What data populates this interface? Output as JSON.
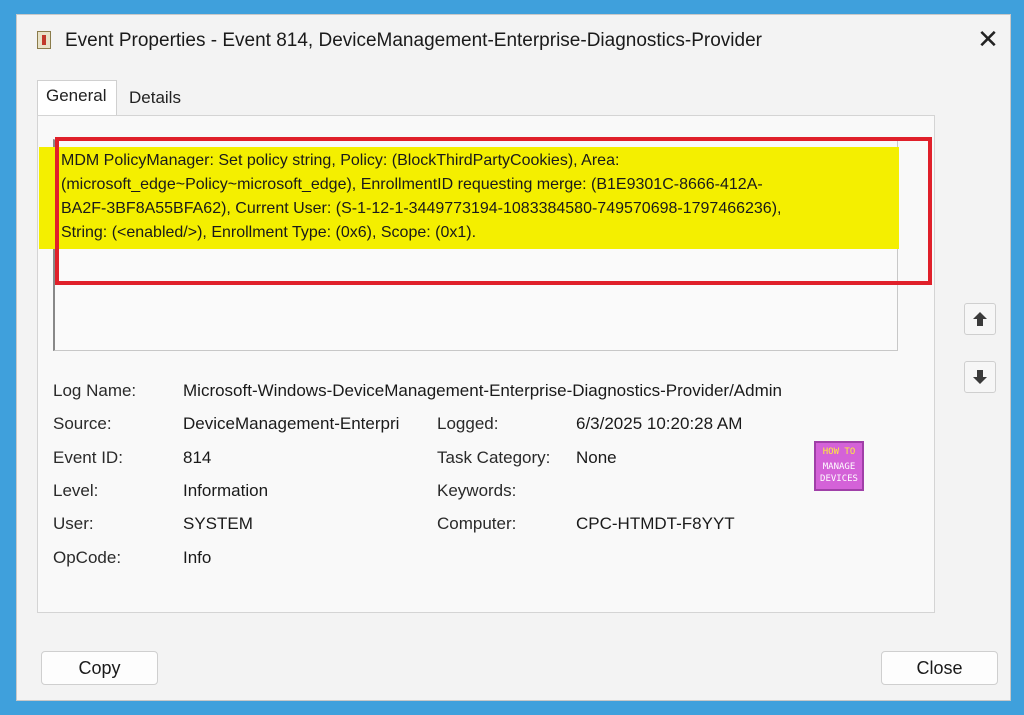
{
  "window": {
    "title": "Event Properties - Event 814, DeviceManagement-Enterprise-Diagnostics-Provider",
    "close_glyph": "✕"
  },
  "tabs": [
    {
      "label": "General",
      "active": true
    },
    {
      "label": "Details",
      "active": false
    }
  ],
  "description": {
    "lines": [
      "MDM PolicyManager: Set policy string, Policy: (BlockThirdPartyCookies), Area:",
      "(microsoft_edge~Policy~microsoft_edge), EnrollmentID requesting merge: (B1E9301C-8666-412A-",
      "BA2F-3BF8A55BFA62), Current User: (S-1-12-1-3449773194-1083384580-749570698-1797466236),",
      "String: (<enabled/>), Enrollment Type: (0x6), Scope: (0x1)."
    ],
    "highlight_color": "#f4ef00",
    "annotation_color": "#e0202a"
  },
  "nav": {
    "up_icon": "arrow-up-icon",
    "down_icon": "arrow-down-icon"
  },
  "fields": {
    "log_name_label": "Log Name:",
    "log_name": "Microsoft-Windows-DeviceManagement-Enterprise-Diagnostics-Provider/Admin",
    "source_label": "Source:",
    "source": "DeviceManagement-Enterpri",
    "logged_label": "Logged:",
    "logged": "6/3/2025 10:20:28 AM",
    "event_id_label": "Event ID:",
    "event_id": "814",
    "task_category_label": "Task Category:",
    "task_category": "None",
    "level_label": "Level:",
    "level": "Information",
    "keywords_label": "Keywords:",
    "keywords": "",
    "user_label": "User:",
    "user": "SYSTEM",
    "computer_label": "Computer:",
    "computer": "CPC-HTMDT-F8YYT",
    "opcode_label": "OpCode:",
    "opcode": "Info"
  },
  "logo": {
    "line1": "HOW TO",
    "line2": "MANAGE",
    "line3": "DEVICES"
  },
  "buttons": {
    "copy": "Copy",
    "close": "Close"
  },
  "colors": {
    "background": "#3fa0dc",
    "window": "#f3f3f3"
  }
}
